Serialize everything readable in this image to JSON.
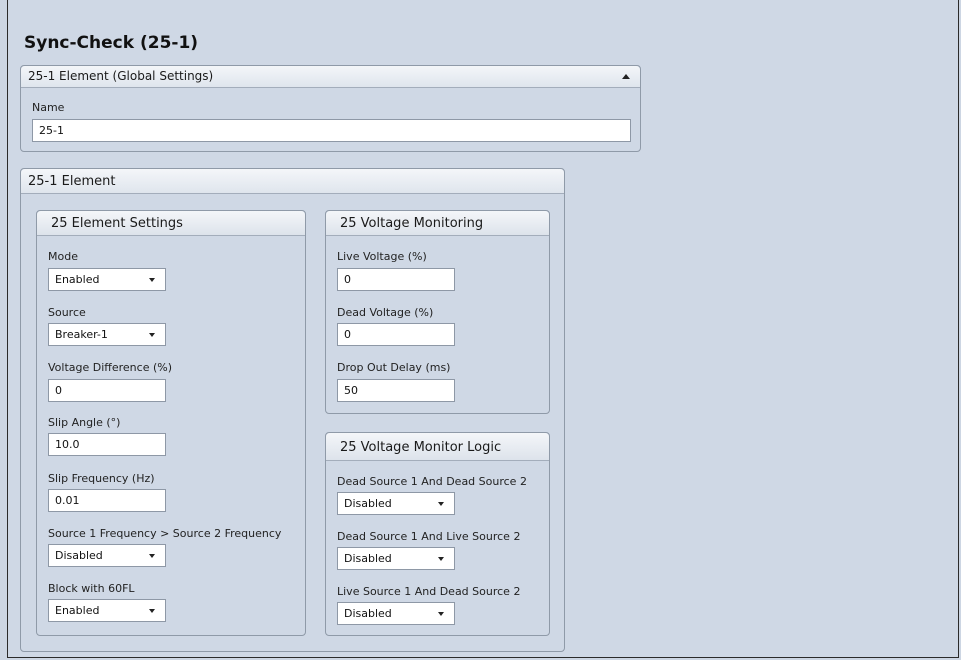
{
  "page": {
    "title": "Sync-Check (25-1)"
  },
  "global_panel": {
    "header": "25-1 Element (Global Settings)",
    "name_label": "Name",
    "name_value": "25-1"
  },
  "element_panel": {
    "header": "25-1 Element",
    "settings": {
      "header": "25 Element Settings",
      "mode_label": "Mode",
      "mode_value": "Enabled",
      "source_label": "Source",
      "source_value": "Breaker-1",
      "voltage_diff_label": "Voltage Difference (%)",
      "voltage_diff_value": "0",
      "slip_angle_label": "Slip Angle (°)",
      "slip_angle_value": "10.0",
      "slip_freq_label": "Slip Frequency (Hz)",
      "slip_freq_value": "0.01",
      "src_freq_label": "Source 1 Frequency > Source 2 Frequency",
      "src_freq_value": "Disabled",
      "block_label": "Block with 60FL",
      "block_value": "Enabled"
    },
    "monitoring": {
      "header": "25 Voltage Monitoring",
      "live_label": "Live Voltage (%)",
      "live_value": "0",
      "dead_label": "Dead Voltage (%)",
      "dead_value": "0",
      "dropout_label": "Drop Out Delay (ms)",
      "dropout_value": "50"
    },
    "logic": {
      "header": "25 Voltage Monitor Logic",
      "dd_label": "Dead Source 1 And Dead Source 2",
      "dd_value": "Disabled",
      "dl_label": "Dead Source 1 And Live Source 2",
      "dl_value": "Disabled",
      "ld_label": "Live Source 1 And Dead Source 2",
      "ld_value": "Disabled"
    }
  }
}
